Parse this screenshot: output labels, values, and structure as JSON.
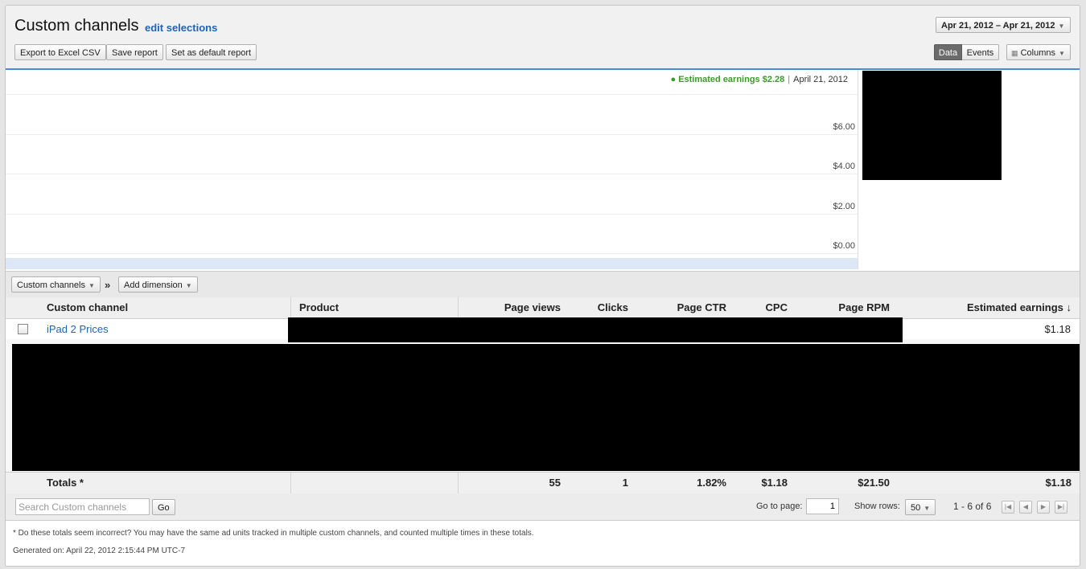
{
  "header": {
    "title": "Custom channels",
    "edit_link": "edit selections",
    "date_range": "Apr 21, 2012 – Apr 21, 2012",
    "export_label": "Export to Excel CSV",
    "save_label": "Save report",
    "default_label": "Set as default report",
    "view_data": "Data",
    "view_events": "Events",
    "columns_label": "Columns"
  },
  "chart": {
    "legend_label": "Estimated earnings $2.28",
    "legend_date": "April 21, 2012",
    "legend_color": "#3a9a2a",
    "y_ticks": [
      "$6.00",
      "$4.00",
      "$2.00",
      "$0.00"
    ]
  },
  "dimensions": {
    "primary": "Custom channels",
    "separator": "»",
    "add": "Add dimension"
  },
  "table": {
    "columns": [
      "Custom channel",
      "Product",
      "Page views",
      "Clicks",
      "Page CTR",
      "CPC",
      "Page RPM",
      "Estimated earnings ↓"
    ],
    "rows": [
      {
        "channel": "iPad 2 Prices",
        "earnings": "$1.18"
      }
    ],
    "totals": {
      "label": "Totals *",
      "page_views": "55",
      "clicks": "1",
      "ctr": "1.82%",
      "cpc": "$1.18",
      "rpm": "$21.50",
      "earnings": "$1.18"
    }
  },
  "footer": {
    "search_placeholder": "Search Custom channels",
    "go_label": "Go",
    "goto_label": "Go to page:",
    "goto_value": "1",
    "show_rows_label": "Show rows:",
    "show_rows_value": "50",
    "range_text": "1 - 6 of 6",
    "note": "* Do these totals seem incorrect? You may have the same ad units tracked in multiple custom channels, and counted multiple times in these totals.",
    "generated": "Generated on: April 22, 2012 2:15:44 PM UTC-7"
  }
}
